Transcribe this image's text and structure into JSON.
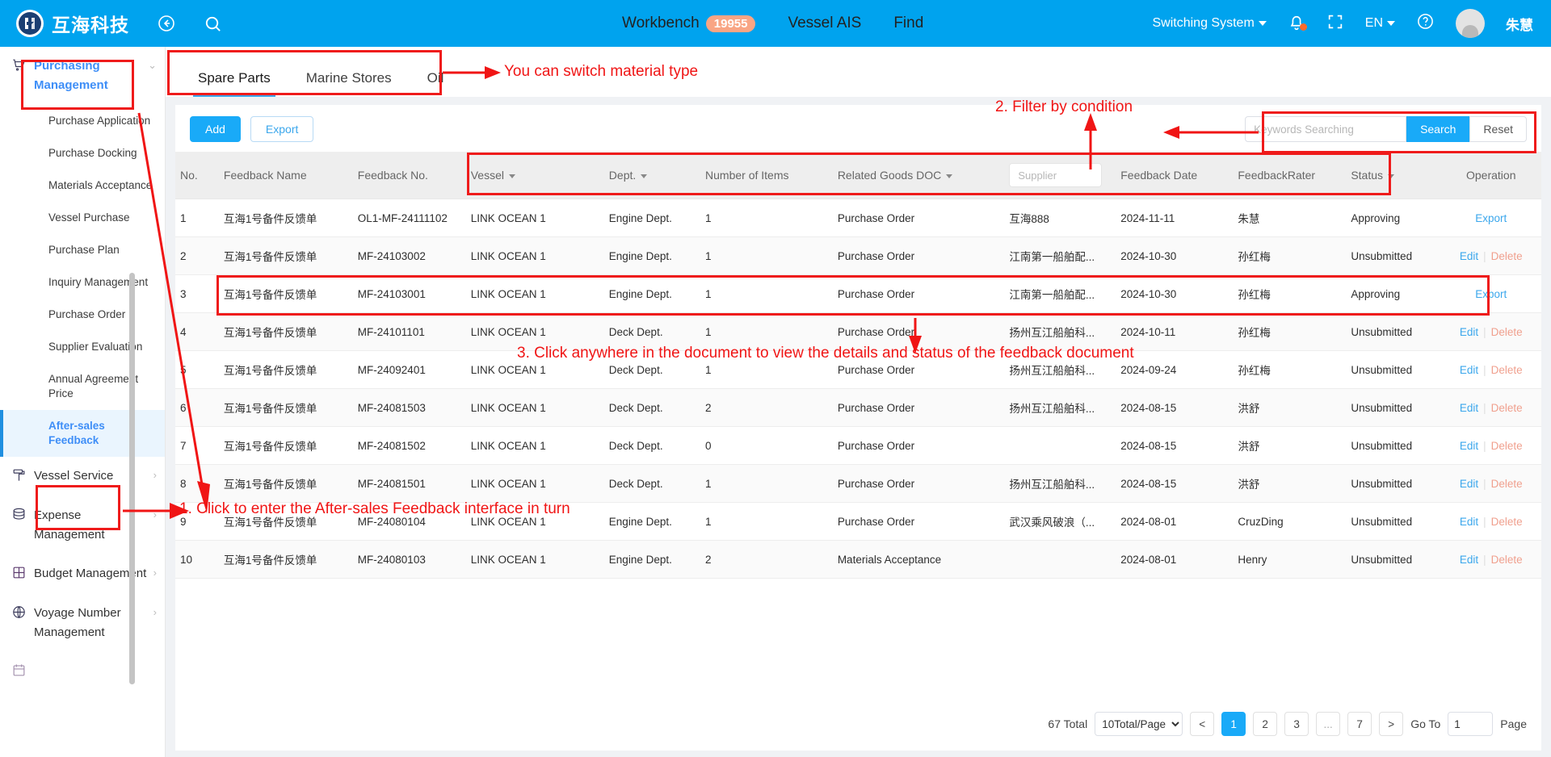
{
  "header": {
    "brand": "互海科技",
    "logo_icon": "company-logo-icon",
    "back_icon": "back-arrow-icon",
    "search_icon": "search-icon",
    "nav": [
      {
        "label": "Workbench",
        "badge": "19955"
      },
      {
        "label": "Vessel AIS",
        "badge": ""
      },
      {
        "label": "Find",
        "badge": ""
      }
    ],
    "switching_system": "Switching System",
    "bell_icon": "notification-bell-icon",
    "fullscreen_icon": "fullscreen-icon",
    "language": "EN",
    "help_icon": "help-circle-icon",
    "user_name": "朱慧"
  },
  "sidebar": {
    "groups": [
      {
        "label": "Purchasing Management",
        "icon": "shopping-cart-icon",
        "active": true,
        "chevron": "chevron-down-icon",
        "items": [
          {
            "label": "Purchase Application",
            "selected": false
          },
          {
            "label": "Purchase Docking",
            "selected": false
          },
          {
            "label": "Materials Acceptance",
            "selected": false
          },
          {
            "label": "Vessel Purchase",
            "selected": false
          },
          {
            "label": "Purchase Plan",
            "selected": false
          },
          {
            "label": "Inquiry Management",
            "selected": false
          },
          {
            "label": "Purchase Order",
            "selected": false
          },
          {
            "label": "Supplier Evaluation",
            "selected": false
          },
          {
            "label": "Annual Agreement Price",
            "selected": false
          },
          {
            "label": "After-sales Feedback",
            "selected": true
          }
        ]
      },
      {
        "label": "Vessel Service",
        "icon": "paint-roller-icon",
        "active": false,
        "chevron": "chevron-right-icon",
        "items": []
      },
      {
        "label": "Expense Management",
        "icon": "database-icon",
        "active": false,
        "chevron": "chevron-right-icon",
        "items": []
      },
      {
        "label": "Budget Management",
        "icon": "budget-grid-icon",
        "active": false,
        "chevron": "chevron-right-icon",
        "items": []
      },
      {
        "label": "Voyage Number Management",
        "icon": "globe-icon",
        "active": false,
        "chevron": "chevron-right-icon",
        "items": []
      }
    ]
  },
  "tabs": [
    {
      "label": "Spare Parts",
      "active": true
    },
    {
      "label": "Marine Stores",
      "active": false
    },
    {
      "label": "Oil",
      "active": false
    }
  ],
  "toolbar": {
    "add_label": "Add",
    "export_label": "Export"
  },
  "search": {
    "placeholder": "Keywords Searching",
    "value": "",
    "search_label": "Search",
    "reset_label": "Reset"
  },
  "table": {
    "columns": [
      {
        "label": "No.",
        "filter": false
      },
      {
        "label": "Feedback Name",
        "filter": false
      },
      {
        "label": "Feedback No.",
        "filter": false
      },
      {
        "label": "Vessel",
        "filter": true
      },
      {
        "label": "Dept.",
        "filter": true
      },
      {
        "label": "Number of Items",
        "filter": false
      },
      {
        "label": "Related Goods DOC",
        "filter": true
      },
      {
        "label": "Supplier",
        "filter": false,
        "input": true,
        "placeholder": "Supplier"
      },
      {
        "label": "Feedback Date",
        "filter": false
      },
      {
        "label": "FeedbackRater",
        "filter": false
      },
      {
        "label": "Status",
        "filter": true
      },
      {
        "label": "Operation",
        "filter": false
      }
    ],
    "rows": [
      {
        "no": "1",
        "name": "互海1号备件反馈单",
        "fbno": "OL1-MF-24111102",
        "vessel": "LINK OCEAN 1",
        "dept": "Engine Dept.",
        "items": "1",
        "doc": "Purchase Order",
        "supplier": "互海888",
        "date": "2024-11-11",
        "rater": "朱慧",
        "status": "Approving",
        "ops": [
          "Export"
        ]
      },
      {
        "no": "2",
        "name": "互海1号备件反馈单",
        "fbno": "MF-24103002",
        "vessel": "LINK OCEAN 1",
        "dept": "Engine Dept.",
        "items": "1",
        "doc": "Purchase Order",
        "supplier": "江南第一船舶配...",
        "date": "2024-10-30",
        "rater": "孙红梅",
        "status": "Unsubmitted",
        "ops": [
          "Edit",
          "Delete"
        ]
      },
      {
        "no": "3",
        "name": "互海1号备件反馈单",
        "fbno": "MF-24103001",
        "vessel": "LINK OCEAN 1",
        "dept": "Engine Dept.",
        "items": "1",
        "doc": "Purchase Order",
        "supplier": "江南第一船舶配...",
        "date": "2024-10-30",
        "rater": "孙红梅",
        "status": "Approving",
        "ops": [
          "Export"
        ]
      },
      {
        "no": "4",
        "name": "互海1号备件反馈单",
        "fbno": "MF-24101101",
        "vessel": "LINK OCEAN 1",
        "dept": "Deck Dept.",
        "items": "1",
        "doc": "Purchase Order",
        "supplier": "扬州互江船舶科...",
        "date": "2024-10-11",
        "rater": "孙红梅",
        "status": "Unsubmitted",
        "ops": [
          "Edit",
          "Delete"
        ]
      },
      {
        "no": "5",
        "name": "互海1号备件反馈单",
        "fbno": "MF-24092401",
        "vessel": "LINK OCEAN 1",
        "dept": "Deck Dept.",
        "items": "1",
        "doc": "Purchase Order",
        "supplier": "扬州互江船舶科...",
        "date": "2024-09-24",
        "rater": "孙红梅",
        "status": "Unsubmitted",
        "ops": [
          "Edit",
          "Delete"
        ]
      },
      {
        "no": "6",
        "name": "互海1号备件反馈单",
        "fbno": "MF-24081503",
        "vessel": "LINK OCEAN 1",
        "dept": "Deck Dept.",
        "items": "2",
        "doc": "Purchase Order",
        "supplier": "扬州互江船舶科...",
        "date": "2024-08-15",
        "rater": "洪舒",
        "status": "Unsubmitted",
        "ops": [
          "Edit",
          "Delete"
        ]
      },
      {
        "no": "7",
        "name": "互海1号备件反馈单",
        "fbno": "MF-24081502",
        "vessel": "LINK OCEAN 1",
        "dept": "Deck Dept.",
        "items": "0",
        "doc": "Purchase Order",
        "supplier": "",
        "date": "2024-08-15",
        "rater": "洪舒",
        "status": "Unsubmitted",
        "ops": [
          "Edit",
          "Delete"
        ]
      },
      {
        "no": "8",
        "name": "互海1号备件反馈单",
        "fbno": "MF-24081501",
        "vessel": "LINK OCEAN 1",
        "dept": "Deck Dept.",
        "items": "1",
        "doc": "Purchase Order",
        "supplier": "扬州互江船舶科...",
        "date": "2024-08-15",
        "rater": "洪舒",
        "status": "Unsubmitted",
        "ops": [
          "Edit",
          "Delete"
        ]
      },
      {
        "no": "9",
        "name": "互海1号备件反馈单",
        "fbno": "MF-24080104",
        "vessel": "LINK OCEAN 1",
        "dept": "Engine Dept.",
        "items": "1",
        "doc": "Purchase Order",
        "supplier": "武汉乘风破浪（...",
        "date": "2024-08-01",
        "rater": "CruzDing",
        "status": "Unsubmitted",
        "ops": [
          "Edit",
          "Delete"
        ]
      },
      {
        "no": "10",
        "name": "互海1号备件反馈单",
        "fbno": "MF-24080103",
        "vessel": "LINK OCEAN 1",
        "dept": "Engine Dept.",
        "items": "2",
        "doc": "Materials Acceptance",
        "supplier": "",
        "date": "2024-08-01",
        "rater": "Henry",
        "status": "Unsubmitted",
        "ops": [
          "Edit",
          "Delete"
        ]
      }
    ]
  },
  "pagination": {
    "total_label": "67 Total",
    "page_size": "10Total/Page",
    "prev": "<",
    "next": ">",
    "pages": [
      "1",
      "2",
      "3",
      "...",
      "7"
    ],
    "current": "1",
    "goto_label": "Go To",
    "goto_value": "1",
    "page_suffix": "Page"
  },
  "annotations": [
    {
      "id": "a1",
      "text": "You can switch material type"
    },
    {
      "id": "a2",
      "text": "2. Filter by condition"
    },
    {
      "id": "a3",
      "text": "3. Click anywhere in the document to view the details and status of the feedback document"
    },
    {
      "id": "a4",
      "text": "1. Click to enter the After-sales Feedback interface in turn"
    }
  ],
  "colors": {
    "brand_blue": "#00a3ee",
    "accent": "#19aaf8",
    "annotation_red": "#f01515",
    "badge_orange": "#f9a584"
  }
}
